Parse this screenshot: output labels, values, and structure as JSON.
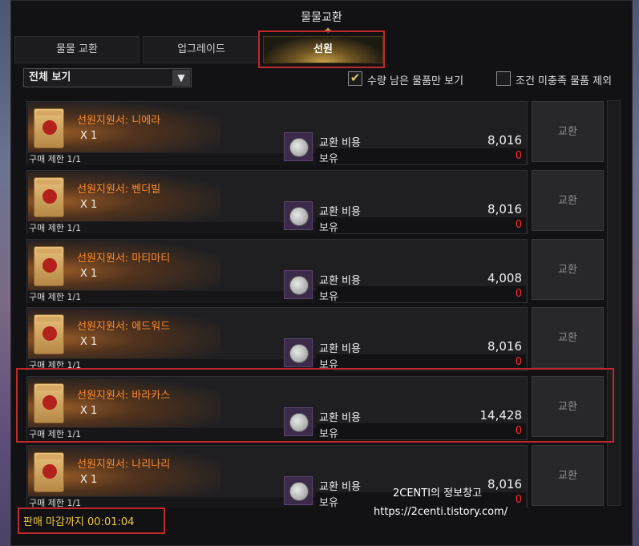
{
  "window": {
    "title": "물물교환"
  },
  "tabs": [
    {
      "label": "물물 교환"
    },
    {
      "label": "업그레이드"
    },
    {
      "label": "선원"
    }
  ],
  "filter": {
    "selected": "전체 보기"
  },
  "options": {
    "remaining_only": {
      "label": "수량 남은 물품만 보기",
      "checked": true
    },
    "exclude_unmet": {
      "label": "조건 미충족 물품 제외",
      "checked": false
    }
  },
  "labels": {
    "cost": "교환 비용",
    "owned": "보유",
    "exchange_button": "교환"
  },
  "items": [
    {
      "name": "선원지원서: 니에라",
      "qty": "X 1",
      "limit": "구매 제한 1/1",
      "cost": "8,016",
      "owned": "0"
    },
    {
      "name": "선원지원서: 벤더빌",
      "qty": "X 1",
      "limit": "구매 제한 1/1",
      "cost": "8,016",
      "owned": "0"
    },
    {
      "name": "선원지원서: 마티마티",
      "qty": "X 1",
      "limit": "구매 제한 1/1",
      "cost": "4,008",
      "owned": "0"
    },
    {
      "name": "선원지원서: 에드워드",
      "qty": "X 1",
      "limit": "구매 제한 1/1",
      "cost": "8,016",
      "owned": "0"
    },
    {
      "name": "선원지원서: 바라카스",
      "qty": "X 1",
      "limit": "구매 제한 1/1",
      "cost": "14,428",
      "owned": "0"
    },
    {
      "name": "선원지원서: 나리나리",
      "qty": "X 1",
      "limit": "구매 제한 1/1",
      "cost": "8,016",
      "owned": "0"
    }
  ],
  "timer": "판매 마감까지 00:01:04",
  "watermark": {
    "line1": "2CENTI의 정보창고",
    "line2": "https://2centi.tistory.com/"
  },
  "colors": {
    "item_name": "#ff8a2a",
    "owned_value": "#ff2a2a",
    "timer": "#f3c93b",
    "highlight": "#c0282a"
  }
}
